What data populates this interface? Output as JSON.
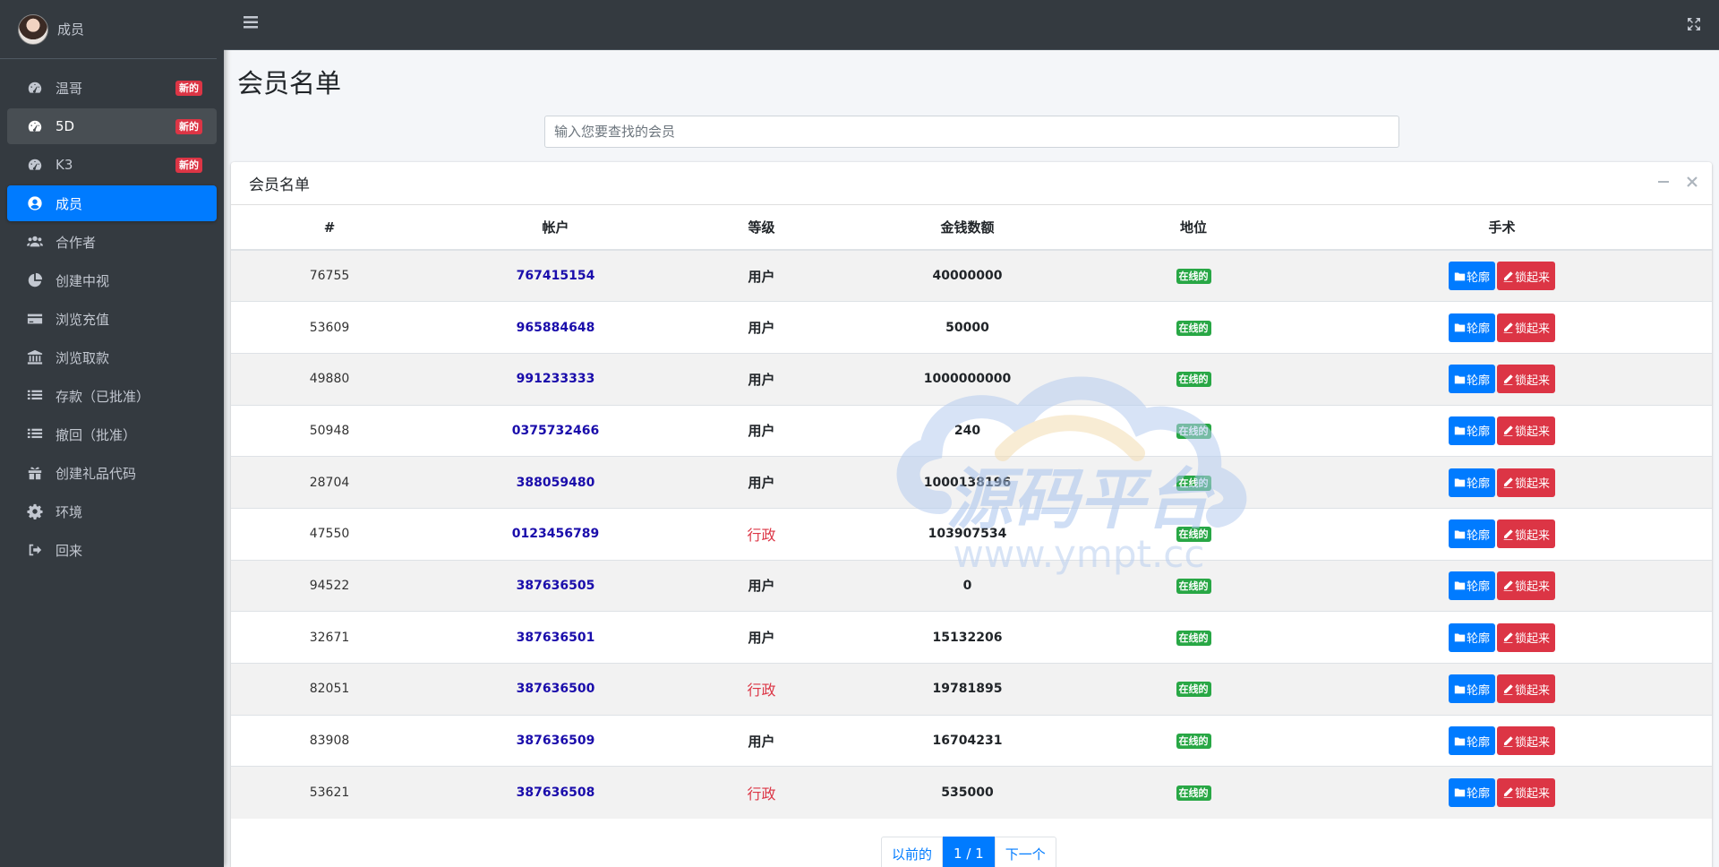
{
  "user": {
    "name": "成员"
  },
  "sidebar": {
    "items": [
      {
        "label": "温哥",
        "icon": "speedometer-icon",
        "badge": "新的"
      },
      {
        "label": "5D",
        "icon": "speedometer-icon",
        "badge": "新的"
      },
      {
        "label": "K3",
        "icon": "speedometer-icon",
        "badge": "新的"
      },
      {
        "label": "成员",
        "icon": "user-circle-icon",
        "badge": ""
      },
      {
        "label": "合作者",
        "icon": "users-icon",
        "badge": ""
      },
      {
        "label": "创建中视",
        "icon": "pie-chart-icon",
        "badge": ""
      },
      {
        "label": "浏览充值",
        "icon": "credit-card-icon",
        "badge": ""
      },
      {
        "label": "浏览取款",
        "icon": "bank-icon",
        "badge": ""
      },
      {
        "label": "存款（已批准）",
        "icon": "list-icon",
        "badge": ""
      },
      {
        "label": "撤回（批准）",
        "icon": "list-icon",
        "badge": ""
      },
      {
        "label": "创建礼品代码",
        "icon": "gift-icon",
        "badge": ""
      },
      {
        "label": "环境",
        "icon": "gear-icon",
        "badge": ""
      },
      {
        "label": "回来",
        "icon": "sign-out-icon",
        "badge": ""
      }
    ]
  },
  "main": {
    "title": "会员名单",
    "search_placeholder": "输入您要查找的会员",
    "card_title": "会员名单",
    "columns": [
      "#",
      "帐户",
      "等级",
      "金钱数额",
      "地位",
      "手术"
    ],
    "rows": [
      {
        "id": "76755",
        "account": "767415154",
        "level": "用户",
        "money": "40000000",
        "status": "在线的"
      },
      {
        "id": "53609",
        "account": "965884648",
        "level": "用户",
        "money": "50000",
        "status": "在线的"
      },
      {
        "id": "49880",
        "account": "991233333",
        "level": "用户",
        "money": "1000000000",
        "status": "在线的"
      },
      {
        "id": "50948",
        "account": "0375732466",
        "level": "用户",
        "money": "240",
        "status": "在线的"
      },
      {
        "id": "28704",
        "account": "388059480",
        "level": "用户",
        "money": "1000138196",
        "status": "在线的"
      },
      {
        "id": "47550",
        "account": "0123456789",
        "level": "行政",
        "money": "103907534",
        "status": "在线的"
      },
      {
        "id": "94522",
        "account": "387636505",
        "level": "用户",
        "money": "0",
        "status": "在线的"
      },
      {
        "id": "32671",
        "account": "387636501",
        "level": "用户",
        "money": "15132206",
        "status": "在线的"
      },
      {
        "id": "82051",
        "account": "387636500",
        "level": "行政",
        "money": "19781895",
        "status": "在线的"
      },
      {
        "id": "83908",
        "account": "387636509",
        "level": "用户",
        "money": "16704231",
        "status": "在线的"
      },
      {
        "id": "53621",
        "account": "387636508",
        "level": "行政",
        "money": "535000",
        "status": "在线的"
      }
    ],
    "profile_button": "轮廓",
    "lock_button": "锁起来",
    "pagination": {
      "prev": "以前的",
      "current": "1 / 1",
      "next": "下一个"
    }
  },
  "watermark": {
    "title": "源码平台",
    "url": "www.ympt.cc"
  },
  "colors": {
    "sidebar": "#343a40",
    "accent": "#007bff",
    "danger": "#dc3545",
    "success": "#28a745"
  }
}
